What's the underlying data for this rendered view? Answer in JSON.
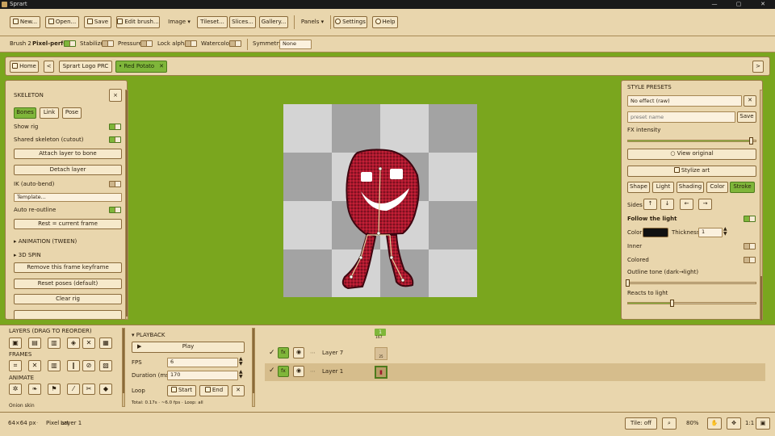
{
  "app": {
    "title": "Sprart",
    "min": "—",
    "max": "▢",
    "close": "✕"
  },
  "toolbar": {
    "new": "New...",
    "open": "Open...",
    "save": "Save",
    "edit_brush": "Edit brush...",
    "image": "Image",
    "tileset": "Tileset...",
    "slices": "Slices...",
    "gallery": "Gallery...",
    "panels": "Panels",
    "settings": "Settings",
    "help": "Help"
  },
  "brushbar": {
    "brush": "Brush 2",
    "pixel_perfect": "Pixel-perfect",
    "stabilize": "Stabilize",
    "pressure": "Pressure",
    "lock_alpha": "Lock alpha",
    "watercolor": "Watercolor",
    "symmetry_label": "Symmetry",
    "symmetry_value": "None"
  },
  "tabs": {
    "home": "Home",
    "prev": "<",
    "next": ">",
    "tab1": "Sprart Logo PRC",
    "tab2": "Red Potato",
    "tab2_close": "✕"
  },
  "skeleton": {
    "title": "SKELETON",
    "close": "×",
    "tab_bones": "Bones",
    "tab_link": "Link",
    "tab_pose": "Pose",
    "show_rig": "Show rig",
    "shared_skeleton": "Shared skeleton (cutout)",
    "attach": "Attach layer to bone",
    "detach": "Detach layer",
    "ik": "IK (auto-bend)",
    "template": "Template...",
    "auto_reoutline": "Auto re-outline",
    "rest": "Rest = current frame",
    "animation": "ANIMATION (TWEEN)",
    "spin": "3D SPIN",
    "remove_kf": "Remove this frame keyframe",
    "reset_poses": "Reset poses (default)",
    "clear_rig": "Clear rig"
  },
  "style": {
    "title": "STYLE PRESETS",
    "no_effect": "No effect (raw)",
    "clear": "✕",
    "preset_placeholder": "preset name",
    "save": "Save",
    "fx_intensity": "FX intensity",
    "fx_intensity_value": 0.97,
    "view_original": "View original",
    "stylize": "Stylize art",
    "tab_shape": "Shape",
    "tab_light": "Light",
    "tab_shading": "Shading",
    "tab_color": "Color",
    "tab_stroke": "Stroke",
    "sides": "Sides",
    "side_up": "↑",
    "side_down": "↓",
    "side_left": "←",
    "side_right": "→",
    "follow_light": "Follow the light",
    "color": "Color",
    "color_value": "#111111",
    "thickness": "Thickness",
    "thickness_value": "1",
    "inner": "Inner",
    "colored": "Colored",
    "outline_tone": "Outline tone (dark→light)",
    "outline_tone_value": 0.0,
    "reacts": "Reacts to light",
    "reacts_value": 0.35
  },
  "layers": {
    "title": "LAYERS (DRAG TO REORDER)",
    "frames": "FRAMES",
    "animate": "ANIMATE",
    "onion": "Onion skin"
  },
  "playback": {
    "title": "PLAYBACK",
    "play": "Play",
    "fps_label": "FPS",
    "fps": "6",
    "duration_label": "Duration (ms)",
    "duration": "170",
    "loop_label": "Loop",
    "start": "Start",
    "end": "End",
    "total": "Total: 0.17s · ~6.0 fps · Loop: all"
  },
  "timeline": {
    "frame_num": "1",
    "frame_ms": "167",
    "rows": [
      {
        "fx": "fx",
        "name": "Layer 7",
        "thumb": "25"
      },
      {
        "fx": "fx",
        "name": "Layer 1",
        "thumb": ""
      }
    ]
  },
  "status": {
    "size": "64×64 px",
    "mode": "Pixel art",
    "layer": "Layer 1",
    "tile": "Tile: off",
    "zoom": "80%",
    "ratio": "1:1"
  },
  "colors": {
    "accent": "#7fb63a",
    "bg": "#7aa61e",
    "panel": "#e9d6ad",
    "potato": "#9e1a2c"
  }
}
